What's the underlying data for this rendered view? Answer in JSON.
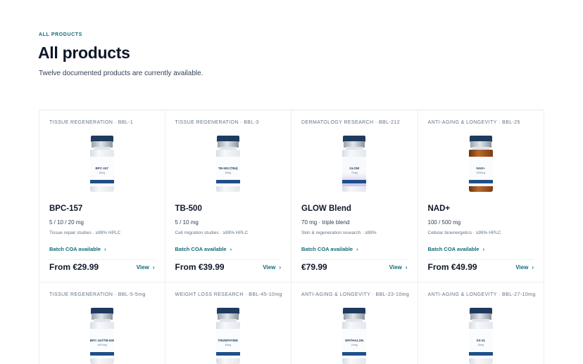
{
  "header": {
    "eyebrow": "ALL PRODUCTS",
    "title": "All products",
    "subtitle": "Twelve documented products are currently available."
  },
  "colors": {
    "accent": "#0f6b78",
    "vial_cap": "#1e3a5f",
    "label_band": "#1e4f8a",
    "amber_glass": "#b86a2e"
  },
  "products": [
    {
      "category": "TISSUE REGENERATION · BBL-1",
      "name": "BPC-157",
      "dose": "5 / 10 / 20 mg",
      "meta": "Tissue repair studies · ≥99% HPLC",
      "coa": "Batch COA available",
      "price": "From €29.99",
      "view": "View",
      "vial_name": "BPC-157",
      "vial_dose": "10mg",
      "glass": "clear"
    },
    {
      "category": "TISSUE REGENERATION · BBL-3",
      "name": "TB-500",
      "dose": "5 / 10 mg",
      "meta": "Cell migration studies · ≥99% HPLC",
      "coa": "Batch COA available",
      "price": "From €39.99",
      "view": "View",
      "vial_name": "TB-500 (TB4)",
      "vial_dose": "10mg",
      "glass": "clear"
    },
    {
      "category": "DERMATOLOGY RESEARCH · BBL-212",
      "name": "GLOW Blend",
      "dose": "70 mg · triple blend",
      "meta": "Skin & regeneration research · ≥99%",
      "coa": "Batch COA available",
      "price": "€79.99",
      "view": "View",
      "vial_name": "GLOW",
      "vial_dose": "70mg",
      "glass": "tinted"
    },
    {
      "category": "ANTI-AGING & LONGEVITY · BBL-25",
      "name": "NAD+",
      "dose": "100 / 500 mg",
      "meta": "Cellular bioenergetics · ≥99% HPLC",
      "coa": "Batch COA available",
      "price": "From €49.99",
      "view": "View",
      "vial_name": "NAD+",
      "vial_dose": "1000mg",
      "glass": "amber"
    },
    {
      "category": "TISSUE REGENERATION · BBL-5-5mg",
      "vial_name": "BPC-157/TB-500",
      "vial_dose": "10/10mg",
      "glass": "clear"
    },
    {
      "category": "WEIGHT LOSS RESEARCH · BBL-45-10mg",
      "vial_name": "TIRZEPATIDE",
      "vial_dose": "10mg",
      "glass": "clear"
    },
    {
      "category": "ANTI-AGING & LONGEVITY · BBL-23-10mg",
      "vial_name": "EPITHALON",
      "vial_dose": "10mg",
      "glass": "clear"
    },
    {
      "category": "ANTI-AGING & LONGEVITY · BBL-27-10mg",
      "vial_name": "SS-31",
      "vial_dose": "10mg",
      "glass": "clear"
    }
  ]
}
